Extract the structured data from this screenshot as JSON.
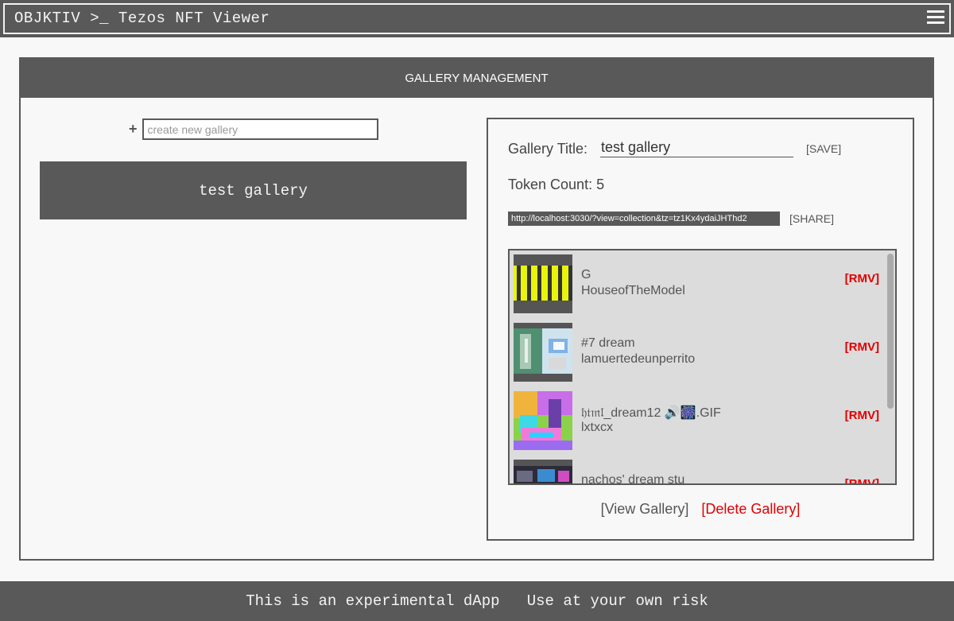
{
  "app": {
    "title": "OBJKTIV >_ Tezos NFT Viewer",
    "menu_icon": "hamburger-menu-icon"
  },
  "panel": {
    "heading": "GALLERY MANAGEMENT"
  },
  "sidebar": {
    "add_icon": "+",
    "new_gallery_placeholder": "create new gallery",
    "new_gallery_value": "",
    "galleries": [
      {
        "label": "test gallery"
      }
    ]
  },
  "detail": {
    "title_label": "Gallery Title:",
    "title_value": "test gallery",
    "save_label": "[SAVE]",
    "token_count_label": "Token Count:",
    "token_count": "5",
    "share_url": "http://localhost:3030/?view=collection&tz=tz1Kx4ydaiJHThd2",
    "share_label": "[SHARE]",
    "remove_label": "[RMV]",
    "tokens": [
      {
        "title": "G",
        "artist": "HouseofTheModel"
      },
      {
        "title": "#7 dream",
        "artist": "lamuertedeunperrito"
      },
      {
        "title": "𝔥𝔱𝔪𝔩_dream12 🔊🎆.GIF",
        "artist": "lxtxcx"
      },
      {
        "title": "nachos' dream stu",
        "artist": ""
      }
    ],
    "view_label": "[View Gallery]",
    "delete_label": "[Delete Gallery]"
  },
  "footer": {
    "text": "This is an experimental dApp   Use at your own risk"
  },
  "colors": {
    "dark": "#595959",
    "background": "#f8f8f8",
    "list_background": "#dcdcdc",
    "danger": "#e00000"
  }
}
